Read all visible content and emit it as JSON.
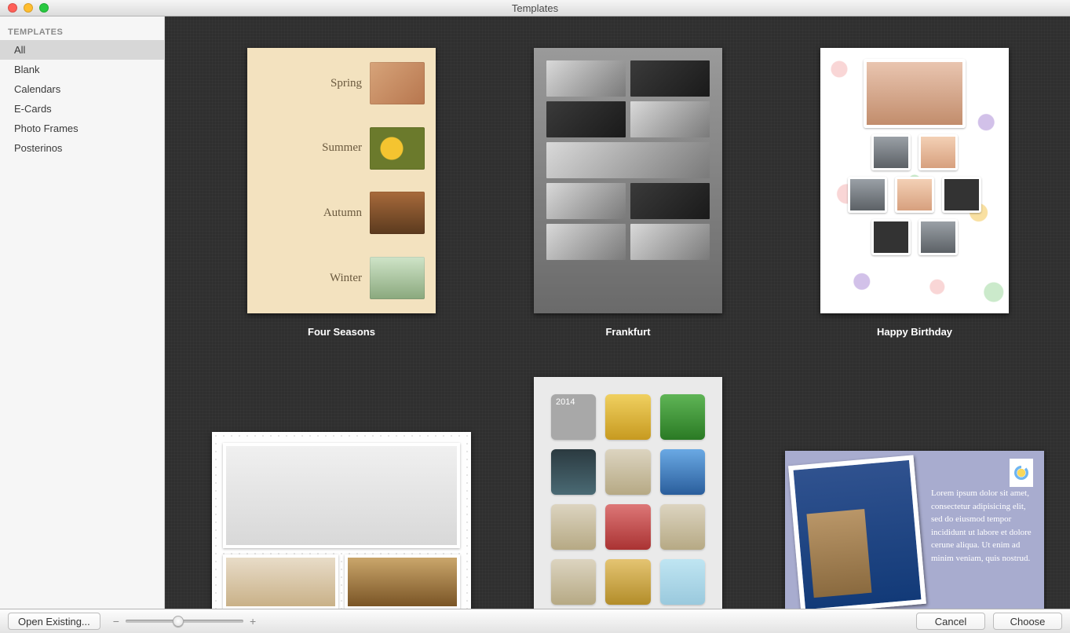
{
  "window": {
    "title": "Templates"
  },
  "sidebar": {
    "header": "TEMPLATES",
    "items": [
      {
        "label": "All",
        "selected": true
      },
      {
        "label": "Blank"
      },
      {
        "label": "Calendars"
      },
      {
        "label": "E-Cards"
      },
      {
        "label": "Photo Frames"
      },
      {
        "label": "Posterinos"
      }
    ]
  },
  "templates": [
    {
      "name": "Four Seasons"
    },
    {
      "name": "Frankfurt"
    },
    {
      "name": "Happy Birthday"
    }
  ],
  "four_seasons": {
    "rows": [
      "Spring",
      "Summer",
      "Autumn",
      "Winter"
    ]
  },
  "grid2014": {
    "year": "2014"
  },
  "postcard": {
    "text": "Lorem ipsum dolor sit amet, consectetur adipisicing elit, sed do eiusmod tempor incididunt ut labore et dolore cerune aliqua. Ut enim ad minim veniam, quis nostrud."
  },
  "bottom": {
    "open_existing": "Open Existing...",
    "cancel": "Cancel",
    "choose": "Choose",
    "zoom_minus": "−",
    "zoom_plus": "+",
    "zoom_value_pct": 45
  }
}
